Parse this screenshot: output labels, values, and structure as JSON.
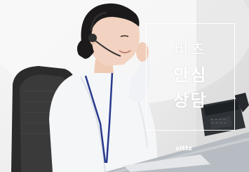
{
  "banner": {
    "title_line1": "비츠",
    "title_line2": "안심",
    "title_line3": "상담",
    "logo_text": "vittz"
  },
  "colors": {
    "background": "#ececec",
    "chair": "#2b2b2b",
    "shirt": "#f4f6f8",
    "hair": "#1c1a1a",
    "skin": "#f2d2c0",
    "phone": "#2e2e2e",
    "lanyard": "#27398c",
    "frame_and_text": "#ffffff"
  },
  "icons": [
    "headset-icon",
    "desk-phone-icon"
  ]
}
